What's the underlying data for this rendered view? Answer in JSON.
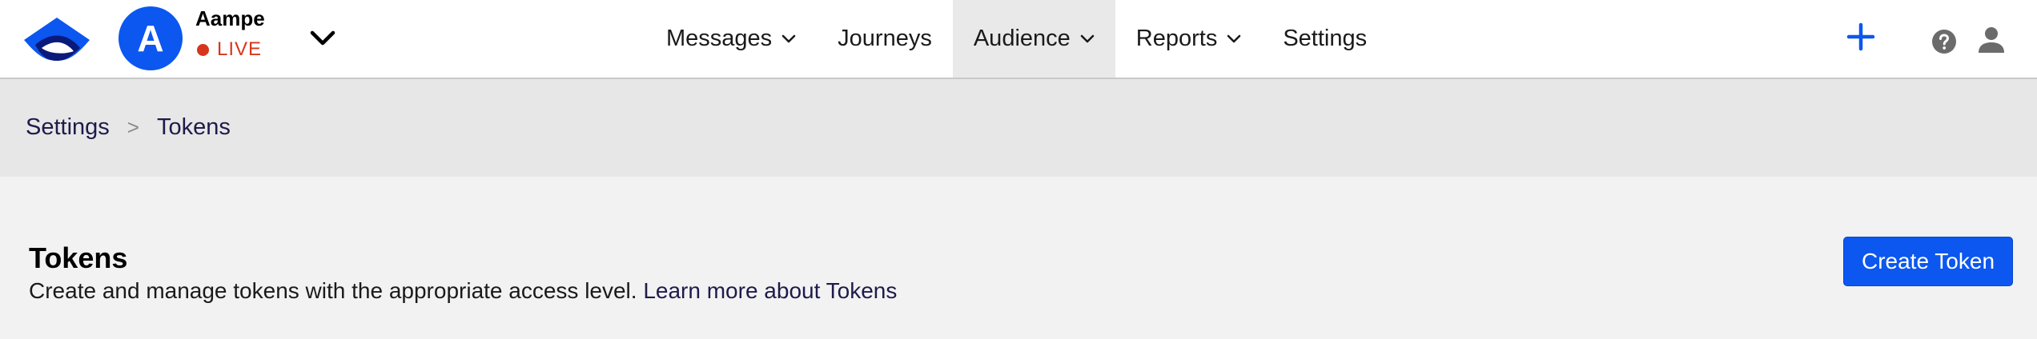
{
  "account": {
    "avatar_letter": "A",
    "name": "Aampe",
    "status": "LIVE"
  },
  "nav": {
    "items": [
      {
        "label": "Messages",
        "has_dropdown": true,
        "active": false
      },
      {
        "label": "Journeys",
        "has_dropdown": false,
        "active": false
      },
      {
        "label": "Audience",
        "has_dropdown": true,
        "active": true
      },
      {
        "label": "Reports",
        "has_dropdown": true,
        "active": false
      },
      {
        "label": "Settings",
        "has_dropdown": false,
        "active": false
      }
    ]
  },
  "header_icons": [
    "plus-icon",
    "help-icon",
    "user-icon",
    "chevron-down-icon",
    "logo-icon"
  ],
  "breadcrumb": {
    "items": [
      "Settings",
      "Tokens"
    ],
    "separator": ">"
  },
  "page": {
    "title": "Tokens",
    "description": "Create and manage tokens with the appropriate access level.",
    "learn_more": "Learn more about Tokens",
    "create_button": "Create Token"
  },
  "colors": {
    "primary": "#0b57f0",
    "live": "#d6361c",
    "link": "#1d1b4a",
    "nav_active_bg": "#e9e9e9",
    "breadcrumb_bg": "#e7e7e7",
    "page_bg": "#f2f2f2"
  }
}
